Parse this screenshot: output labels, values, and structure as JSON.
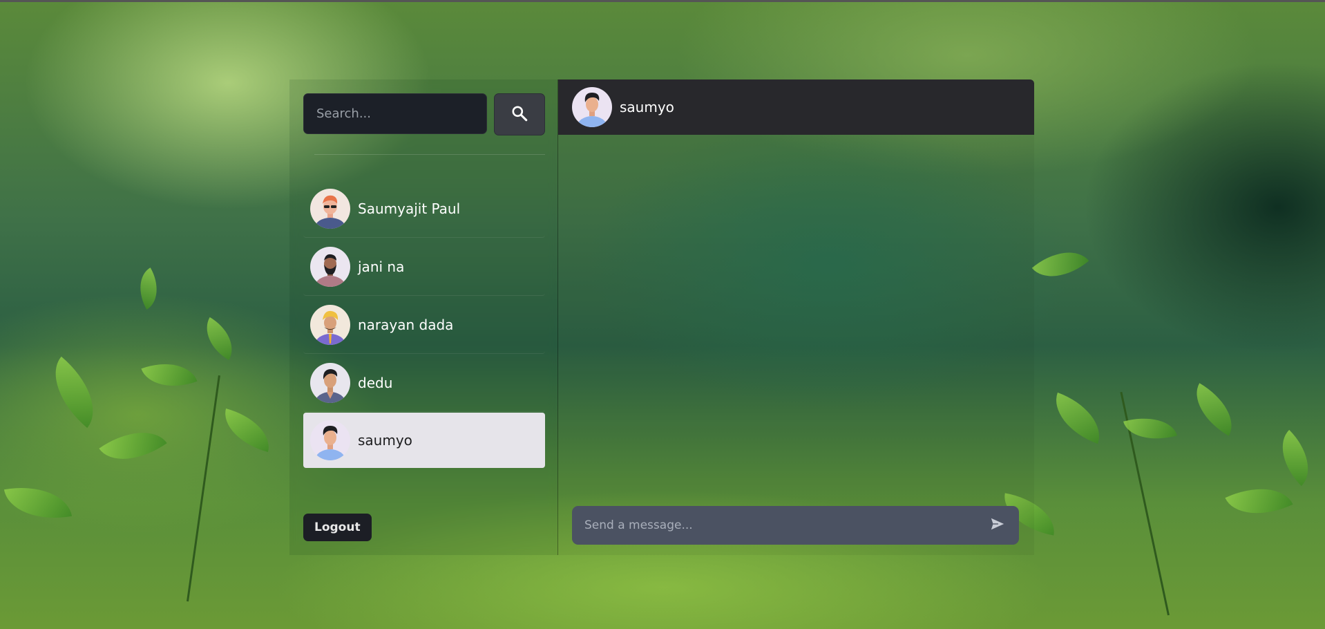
{
  "search": {
    "placeholder": "Search...",
    "button_icon": "search-icon"
  },
  "contacts": [
    {
      "name": "Saumyajit Paul",
      "avatar": "avatar-orange-hair-sunglasses",
      "active": false
    },
    {
      "name": "jani na",
      "avatar": "avatar-bearded-man",
      "active": false
    },
    {
      "name": "narayan dada",
      "avatar": "avatar-turban-man",
      "active": false
    },
    {
      "name": "dedu",
      "avatar": "avatar-dark-hair-man",
      "active": false
    },
    {
      "name": "saumyo",
      "avatar": "avatar-man-blue-shirt",
      "active": true
    }
  ],
  "logout_label": "Logout",
  "chat": {
    "header_name": "saumyo",
    "message_placeholder": "Send a message...",
    "send_icon": "send-icon"
  },
  "colors": {
    "sidebar_active_bg": "#e6e4ea",
    "header_bg": "#28282c",
    "input_bg": "#4b5262",
    "search_bg": "#1c2028"
  }
}
